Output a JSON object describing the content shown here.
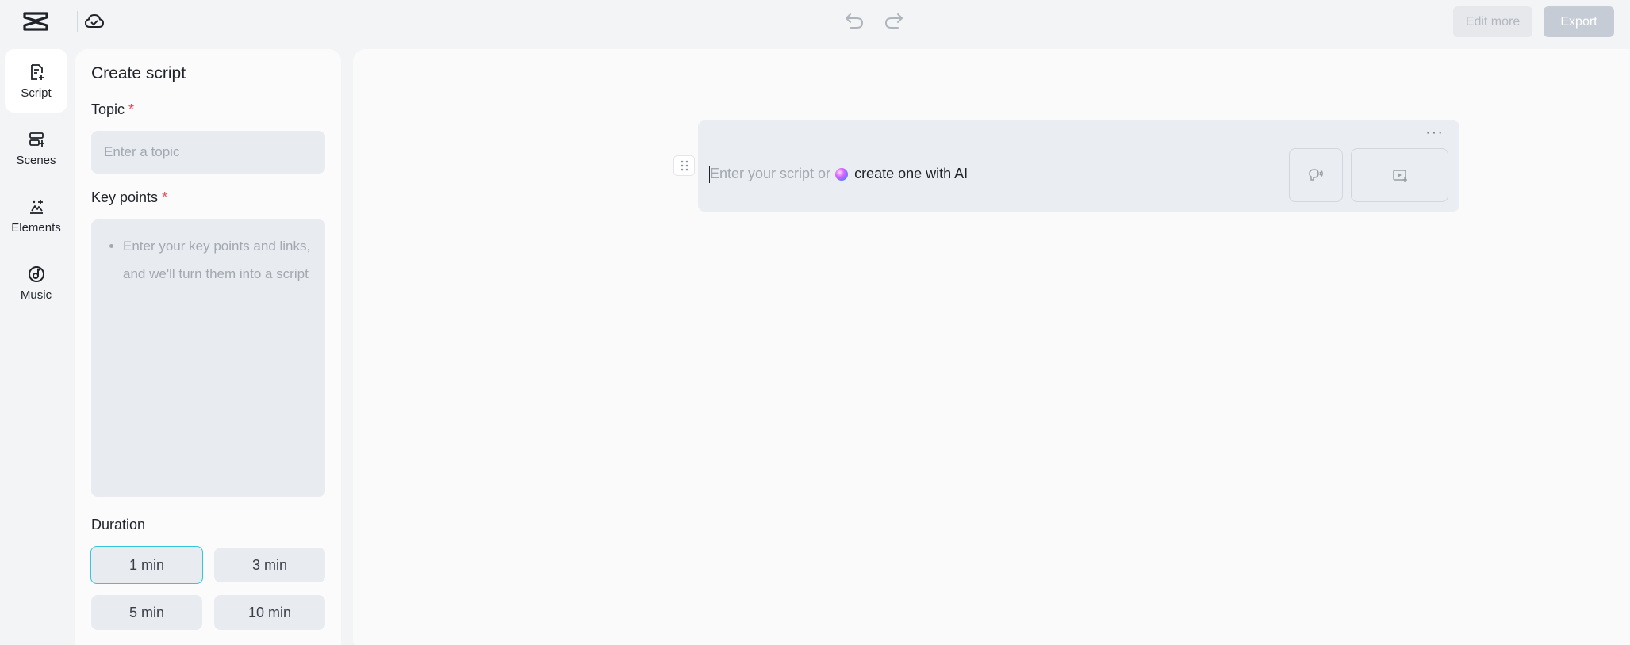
{
  "topbar": {
    "logo_icon": "capcut-logo-icon",
    "cloud_icon": "cloud-icon",
    "undo_icon": "undo-icon",
    "redo_icon": "redo-icon",
    "edit_more_label": "Edit more",
    "export_label": "Export"
  },
  "rail": {
    "items": [
      {
        "label": "Script",
        "icon": "script-icon",
        "active": true
      },
      {
        "label": "Scenes",
        "icon": "scenes-icon",
        "active": false
      },
      {
        "label": "Elements",
        "icon": "elements-icon",
        "active": false
      },
      {
        "label": "Music",
        "icon": "music-icon",
        "active": false
      }
    ]
  },
  "panel": {
    "title": "Create script",
    "topic": {
      "label": "Topic",
      "required_mark": "*",
      "placeholder": "Enter a topic",
      "value": ""
    },
    "key_points": {
      "label": "Key points",
      "required_mark": "*",
      "placeholder": "Enter your key points and links, and we'll turn them into a script"
    },
    "duration": {
      "label": "Duration",
      "options": [
        "1 min",
        "3 min",
        "5 min",
        "10 min"
      ],
      "selected": "1 min"
    }
  },
  "editor": {
    "placeholder_prefix": "Enter your script or",
    "ai_link": "create one with AI",
    "more_icon": "more-dots-icon",
    "drag_icon": "drag-handle-icon",
    "voice_icon": "voice-icon",
    "media_icon": "add-media-icon"
  },
  "colors": {
    "accent": "#34c7d9",
    "required": "#f5455c",
    "export_disabled": "#c6ccd5"
  }
}
